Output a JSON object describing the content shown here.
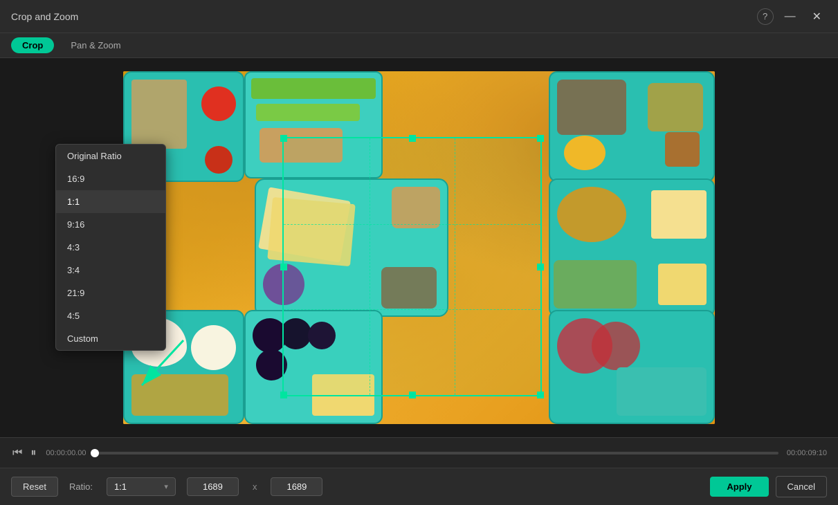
{
  "window": {
    "title": "Crop and Zoom",
    "help_btn": "?",
    "minimize_btn": "—",
    "close_btn": "✕"
  },
  "tabs": {
    "crop": {
      "label": "Crop",
      "active": true
    },
    "pan_zoom": {
      "label": "Pan & Zoom",
      "active": false
    }
  },
  "ratio_dropdown": {
    "items": [
      {
        "label": "Original Ratio",
        "selected": false
      },
      {
        "label": "16:9",
        "selected": false
      },
      {
        "label": "1:1",
        "selected": true
      },
      {
        "label": "9:16",
        "selected": false
      },
      {
        "label": "4:3",
        "selected": false
      },
      {
        "label": "3:4",
        "selected": false
      },
      {
        "label": "21:9",
        "selected": false
      },
      {
        "label": "4:5",
        "selected": false
      },
      {
        "label": "Custom",
        "selected": false
      }
    ]
  },
  "timeline": {
    "current_time": "00:00:00.00",
    "total_time": "00:00:09:10"
  },
  "bottom_controls": {
    "reset_label": "Reset",
    "ratio_label": "Ratio:",
    "ratio_value": "1:1",
    "dim_width": "1689",
    "dim_x": "x",
    "dim_height": "1689",
    "apply_label": "Apply",
    "cancel_label": "Cancel"
  }
}
